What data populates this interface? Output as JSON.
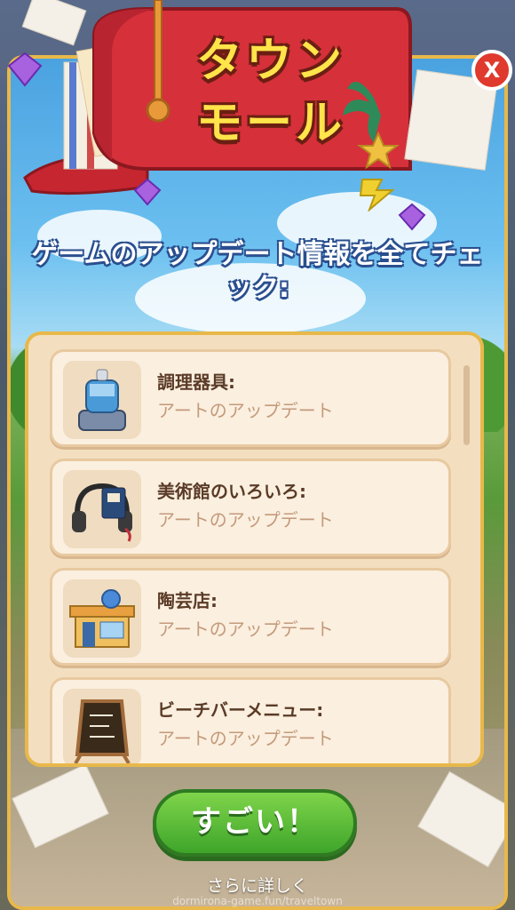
{
  "header": {
    "title_line1": "タウン",
    "title_line2": "モール"
  },
  "close_label": "X",
  "heading": "ゲームのアップデート情報を全てチェック:",
  "items": [
    {
      "title": "調理器具:",
      "subtitle": "アートのアップデート",
      "icon": "cooking-appliance-icon"
    },
    {
      "title": "美術館のいろいろ:",
      "subtitle": "アートのアップデート",
      "icon": "headphones-icon"
    },
    {
      "title": "陶芸店:",
      "subtitle": "アートのアップデート",
      "icon": "pottery-shop-icon"
    },
    {
      "title": "ビーチバーメニュー:",
      "subtitle": "アートのアップデート",
      "icon": "menu-board-icon"
    }
  ],
  "primary_button": "すごい！",
  "more_link": "さらに詳しく",
  "watermark": "dormirona-game.fun/traveltown",
  "colors": {
    "frame_gold": "#e8b84a",
    "title_yellow": "#ffe44a",
    "mailbox_red": "#d6303a",
    "button_green": "#3ea52a",
    "close_red": "#e0392d"
  }
}
